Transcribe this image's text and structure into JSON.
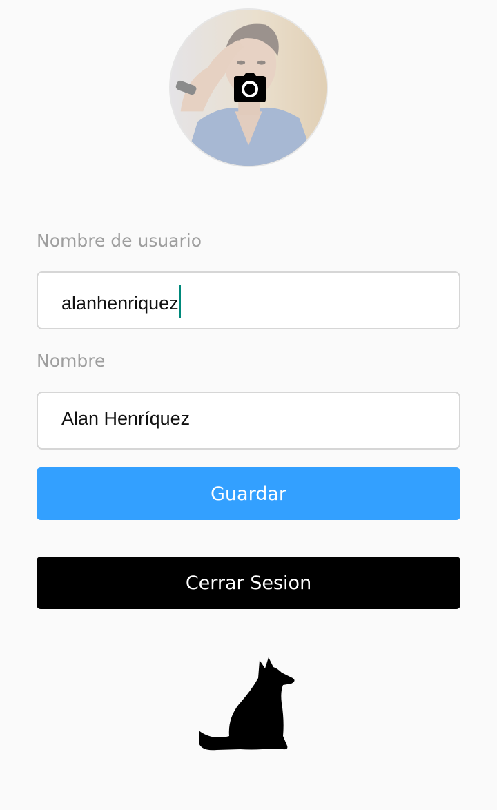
{
  "profile": {
    "avatar_alt": "",
    "camera_icon": "camera-icon"
  },
  "form": {
    "username_label": "Nombre de usuario",
    "username_value": "alanhenriquez",
    "name_label": "Nombre",
    "name_value": "Alan Henríquez"
  },
  "actions": {
    "save_label": "Guardar",
    "logout_label": "Cerrar Sesion"
  },
  "colors": {
    "background": "#fafafa",
    "save_button": "#33a0ff",
    "logout_button": "#000000",
    "caret": "#00897b",
    "label": "#9e9e9e"
  },
  "logo": {
    "icon": "dog-icon"
  }
}
